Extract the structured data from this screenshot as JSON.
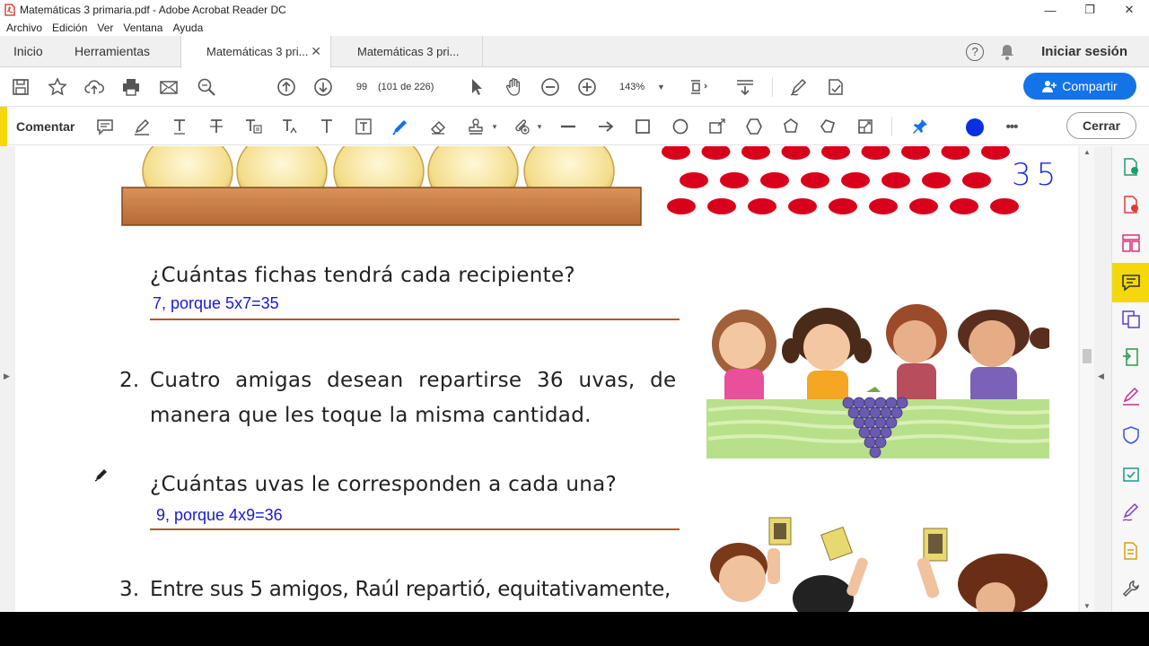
{
  "window": {
    "title": "Matemáticas 3 primaria.pdf - Adobe Acrobat Reader DC",
    "minimize": "—",
    "restore": "❐",
    "close": "✕"
  },
  "menu": [
    "Archivo",
    "Edición",
    "Ver",
    "Ventana",
    "Ayuda"
  ],
  "tabs": {
    "home": "Inicio",
    "tools": "Herramientas",
    "documents": [
      {
        "label": "Matemáticas 3 pri...",
        "close": "✕"
      },
      {
        "label": "Matemáticas 3 pri..."
      }
    ],
    "sign_in": "Iniciar sesión",
    "help": "?"
  },
  "toolbar": {
    "page_number": "99",
    "page_count": "(101 de 226)",
    "zoom": "143%",
    "zoom_caret": "▼",
    "share_label": "Compartir"
  },
  "comment_toolbar": {
    "label": "Comentar",
    "close_label": "Cerrar",
    "more": "•••",
    "color_accent": "#f4d80c",
    "pen_color": "#0a2fe3"
  },
  "document": {
    "q1_question": "¿Cuántas fichas tendrá cada recipiente?",
    "q1_answer": "7, porque 5x7=35",
    "handwritten_35": "35",
    "q2_number": "2.",
    "q2_line1": "Cuatro amigas desean repartirse 36 uvas, de",
    "q2_line2": "manera que les toque la misma cantidad.",
    "q2_question": "¿Cuántas uvas le corresponden a cada una?",
    "q2_answer": "9, porque 4x9=36",
    "q3_number": "3.",
    "q3_line1": "Entre sus 5 amigos, Raúl repartió, equitativamente,"
  },
  "colors": {
    "answer_text": "#1a1acf",
    "underline": "#b0582a",
    "chip": "#d9001b",
    "share_button": "#1473e6"
  }
}
